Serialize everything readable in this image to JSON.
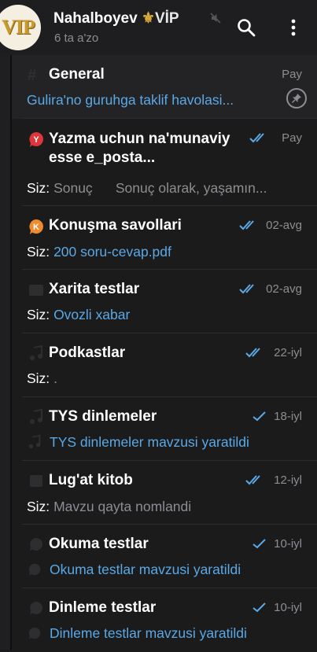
{
  "header": {
    "avatar_text": "VIP",
    "title_name": "Nahalboyev ",
    "title_fleur": "⚜",
    "title_vip": "VİP",
    "subtitle": "6 ta a'zo",
    "icons": [
      "mute-icon",
      "search-icon",
      "more-vert-icon"
    ]
  },
  "topics": [
    {
      "title": "General",
      "time": "Pay",
      "preview": "Gulira'no guruhga taklif havolasi...",
      "checks": "none",
      "pinned": true
    },
    {
      "title": "Yazma uchun na'munaviy esse e_posta...",
      "time": "Pay",
      "sender": "Siz:",
      "preview": "Sonuç      Sonuç olarak, yaşamın...",
      "checks": "double",
      "icon": "Y",
      "icon_color": "#e0353b"
    },
    {
      "title": "Konuşma savollari",
      "time": "02-avg",
      "sender": "Siz:",
      "preview": "200 soru-cevap.pdf",
      "checks": "double",
      "icon": "K",
      "icon_color": "#f08a2e"
    },
    {
      "title": "Xarita testlar",
      "time": "02-avg",
      "sender": "Siz:",
      "preview": "Ovozli xabar",
      "checks": "double"
    },
    {
      "title": "Podkastlar",
      "time": "22-iyl",
      "sender": "Siz:",
      "preview": ".",
      "checks": "double"
    },
    {
      "title": "TYS dinlemeler",
      "time": "18-iyl",
      "preview": "TYS dinlemeler mavzusi yaratildi",
      "checks": "single"
    },
    {
      "title": "Lug'at kitob",
      "time": "12-iyl",
      "sender": "Siz:",
      "preview": "Mavzu qayta nomlandi",
      "checks": "double"
    },
    {
      "title": "Okuma testlar",
      "time": "10-iyl",
      "preview": "Okuma testlar mavzusi yaratildi",
      "checks": "single"
    },
    {
      "title": "Dinleme testlar",
      "time": "10-iyl",
      "preview": "Dinleme testlar mavzusi yaratildi",
      "checks": "single"
    }
  ],
  "colors": {
    "accent_blue": "#5aa9e6",
    "background": "#1b1b1c",
    "muted": "#8d8d93"
  }
}
